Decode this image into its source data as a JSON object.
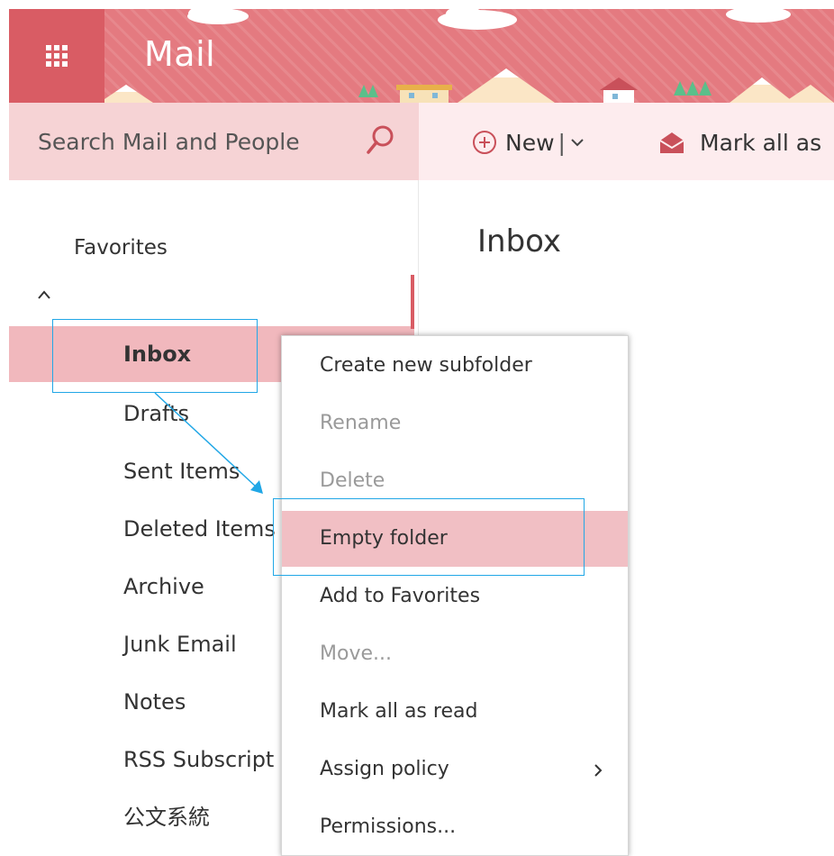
{
  "header": {
    "app_title": "Mail",
    "launcher_icon": "waffle-icon",
    "bg_color": "#e47a80",
    "launcher_color": "#d95c64"
  },
  "search": {
    "placeholder": "Search Mail and People",
    "icon": "search-icon"
  },
  "toolbar": {
    "new_label": "New",
    "new_separator": "|",
    "mark_all_label": "Mark all as"
  },
  "nav": {
    "favorites_label": "Favorites",
    "folders": [
      {
        "label": "Inbox",
        "selected": true
      },
      {
        "label": "Drafts"
      },
      {
        "label": "Sent Items"
      },
      {
        "label": "Deleted Items"
      },
      {
        "label": "Archive"
      },
      {
        "label": "Junk Email"
      },
      {
        "label": "Notes"
      },
      {
        "label": "RSS Subscript"
      },
      {
        "label": "公文系統"
      }
    ]
  },
  "main": {
    "title": "Inbox"
  },
  "context_menu": {
    "items": [
      {
        "label": "Create new subfolder",
        "enabled": true
      },
      {
        "label": "Rename",
        "enabled": false
      },
      {
        "label": "Delete",
        "enabled": false
      },
      {
        "label": "Empty folder",
        "enabled": true,
        "highlighted": true
      },
      {
        "label": "Add to Favorites",
        "enabled": true
      },
      {
        "label": "Move...",
        "enabled": false
      },
      {
        "label": "Mark all as read",
        "enabled": true
      },
      {
        "label": "Assign policy",
        "enabled": true,
        "has_submenu": true
      },
      {
        "label": "Permissions...",
        "enabled": true
      }
    ]
  },
  "colors": {
    "accent": "#d95c64",
    "selected_bg": "#f1b8bd",
    "annotation": "#21a7e6"
  }
}
